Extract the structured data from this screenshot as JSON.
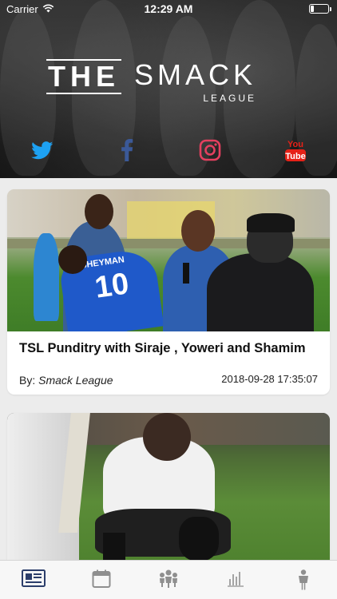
{
  "status_bar": {
    "carrier": "Carrier",
    "time": "12:29 AM"
  },
  "header": {
    "logo_the": "THE",
    "logo_smack": "SMACK",
    "logo_league": "LEAGUE",
    "social": [
      {
        "icon": "twitter-icon",
        "color": "#1da1f2"
      },
      {
        "icon": "facebook-icon",
        "color": "#3b5998"
      },
      {
        "icon": "instagram-icon",
        "color": "#e4405f"
      },
      {
        "icon": "youtube-icon",
        "color": "#e62117",
        "label": "You Tube"
      }
    ]
  },
  "feed": [
    {
      "title": "TSL Punditry with Siraje , Yoweri and Shamim",
      "author_prefix": "By:",
      "author": "Smack League",
      "date": "2018-09-28 17:35:07",
      "jersey_name": "SHEYMAN",
      "jersey_number": "10"
    },
    {
      "title": "",
      "author": "",
      "date": ""
    }
  ],
  "tabbar": {
    "active_color": "#2c3e6b",
    "inactive_color": "#9a9a9a",
    "tabs": [
      {
        "icon": "news-icon",
        "active": true
      },
      {
        "icon": "calendar-icon",
        "active": false
      },
      {
        "icon": "teams-icon",
        "active": false
      },
      {
        "icon": "stats-icon",
        "active": false
      },
      {
        "icon": "player-icon",
        "active": false
      }
    ]
  }
}
